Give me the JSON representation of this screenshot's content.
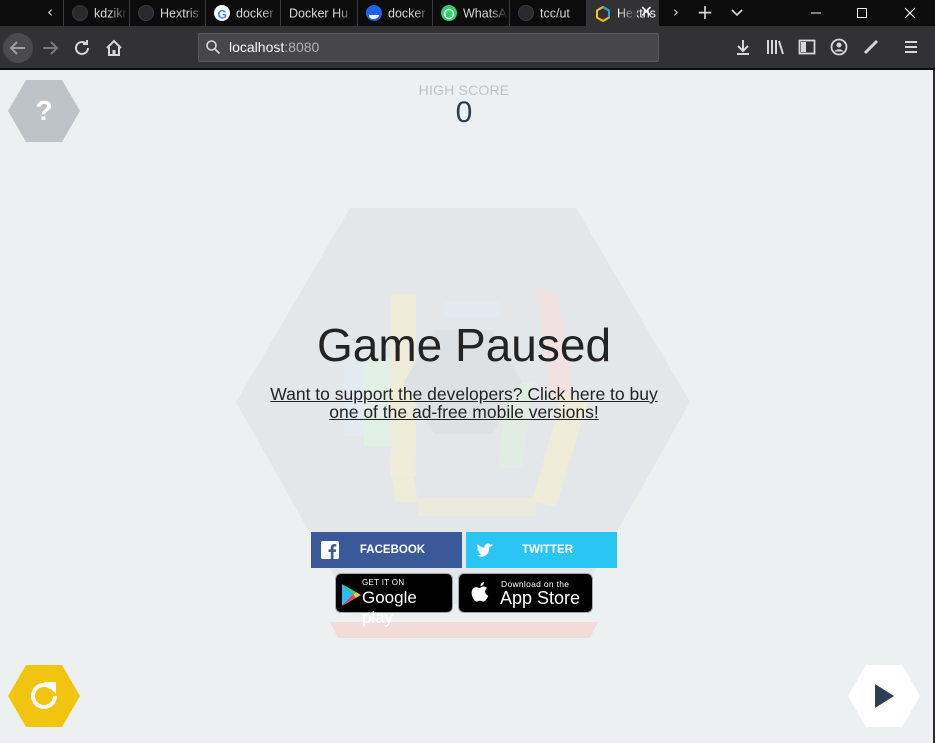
{
  "browser": {
    "tabs": [
      {
        "label": "kdzikr",
        "favicon": "github-icon",
        "color": "#24292e"
      },
      {
        "label": "Hextris",
        "favicon": "github-icon",
        "color": "#24292e"
      },
      {
        "label": "docker",
        "favicon": "google-icon",
        "color": "#4285f4"
      },
      {
        "label": "Docker Hu",
        "favicon": "",
        "color": ""
      },
      {
        "label": "docker",
        "favicon": "docker-icon",
        "color": "#2496ed"
      },
      {
        "label": "WhatsApp",
        "favicon": "whatsapp-icon",
        "color": "#25d366"
      },
      {
        "label": "tcc/ut",
        "favicon": "github-icon",
        "color": "#24292e"
      },
      {
        "label": "Hextris",
        "favicon": "hextris-icon",
        "color": "#f1c40f",
        "active": true
      }
    ],
    "new_tab_label": "+",
    "url_host": "localhost",
    "url_port": ":8080"
  },
  "game": {
    "high_score_label": "HIGH SCORE",
    "high_score_value": "0",
    "title": "Game Paused",
    "support_link": "Want to support the developers? Click here to buy one of the ad-free mobile versions!",
    "help_label": "?",
    "facebook_label": "FACEBOOK",
    "twitter_label": "TWITTER",
    "google_play_small": "GET IT ON",
    "google_play_big": "Google play",
    "app_store_small": "Download on the",
    "app_store_big": "App Store"
  },
  "colors": {
    "facebook": "#3b5998",
    "twitter": "#2ac6f3",
    "restart": "#f1c40f",
    "background": "#ecf0f1",
    "hexagon": "#bdc3c7"
  }
}
